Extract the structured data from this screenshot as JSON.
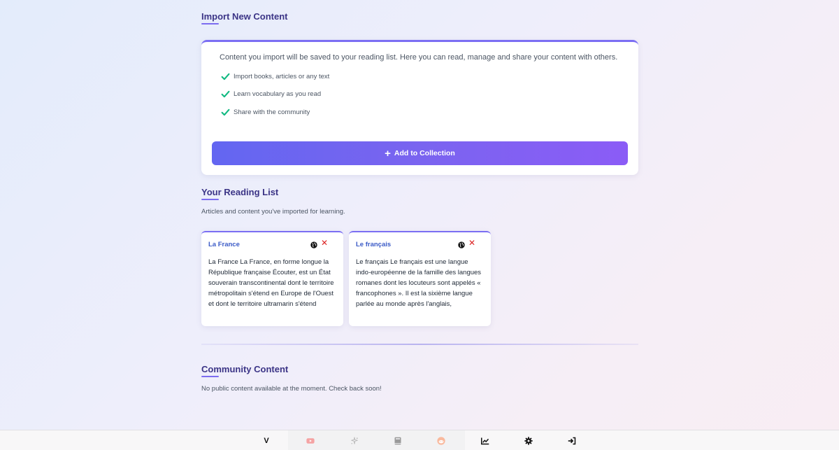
{
  "import": {
    "title": "Import New Content",
    "description": "Content you import will be saved to your reading list. Here you can read, manage and share your content with others.",
    "features": [
      "Import books, articles or any text",
      "Learn vocabulary as you read",
      "Share with the community"
    ],
    "add_button_label": "Add to Collection"
  },
  "reading_list": {
    "title": "Your Reading List",
    "subtitle": "Articles and content you've imported for learning.",
    "articles": [
      {
        "title": "La France",
        "excerpt": "La France La France, en forme longue la République française Écouter, est un État souverain transcontinental dont le territoire métropolitain s'étend en Europe de l'Ouest et dont le territoire ultramarin s'étend"
      },
      {
        "title": "Le français",
        "excerpt": "Le français Le français est une langue indo-européenne de la famille des langues romanes dont les locuteurs sont appelés « francophones ». Il est la sixième langue parlée au monde après l'anglais,"
      }
    ]
  },
  "community": {
    "title": "Community Content",
    "empty_message": "No public content available at the moment. Check back soon!"
  },
  "bottom_nav": {
    "brand": "V",
    "items": [
      "youtube-icon",
      "sparkle-icon",
      "book-icon",
      "reddit-icon",
      "chart-line-icon",
      "gear-icon",
      "sign-in-icon"
    ]
  },
  "colors": {
    "accent": "#7b6ef3",
    "button_start": "#6366f1",
    "button_end": "#8b5cf6",
    "check": "#10b981",
    "delete": "#dc2626",
    "title": "#3b3486",
    "link": "#3b5bc7"
  }
}
